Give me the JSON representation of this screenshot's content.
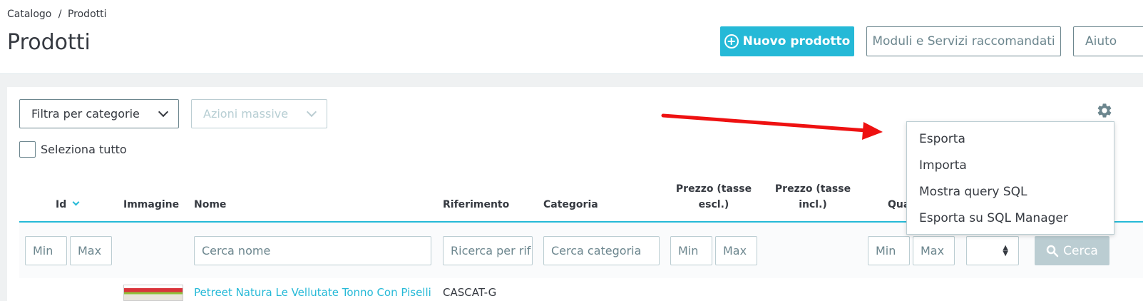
{
  "breadcrumb": {
    "parent": "Catalogo",
    "separator": "/",
    "current": "Prodotti"
  },
  "page_title": "Prodotti",
  "toolbar": {
    "new_product": "Nuovo prodotto",
    "modules": "Moduli e Servizi raccomandati",
    "help": "Aiuto"
  },
  "filters": {
    "category_filter": "Filtra per categorie",
    "bulk_actions": "Azioni massive",
    "select_all": "Seleziona tutto"
  },
  "columns": {
    "id": "Id",
    "image": "Immagine",
    "name": "Nome",
    "reference": "Riferimento",
    "category": "Categoria",
    "price_excl_1": "Prezzo (tasse",
    "price_excl_2": "escl.)",
    "price_incl_1": "Prezzo (tasse",
    "price_incl_2": "incl.)",
    "quantity": "Qua"
  },
  "filter_inputs": {
    "min": "Min",
    "max": "Max",
    "name": "Cerca nome",
    "reference": "Ricerca per rif",
    "category": "Cerca categoria",
    "search_button": "Cerca"
  },
  "row": {
    "name": "Petreet Natura Le Vellutate Tonno Con Piselli gr",
    "reference": "CASCAT-G"
  },
  "dropdown": {
    "items": [
      "Esporta",
      "Importa",
      "Mostra query SQL",
      "Esporta su SQL Manager"
    ]
  },
  "colors": {
    "accent": "#25b9d7",
    "text": "#363a41",
    "muted": "#6c868e",
    "annotation_arrow": "#ee1111"
  }
}
